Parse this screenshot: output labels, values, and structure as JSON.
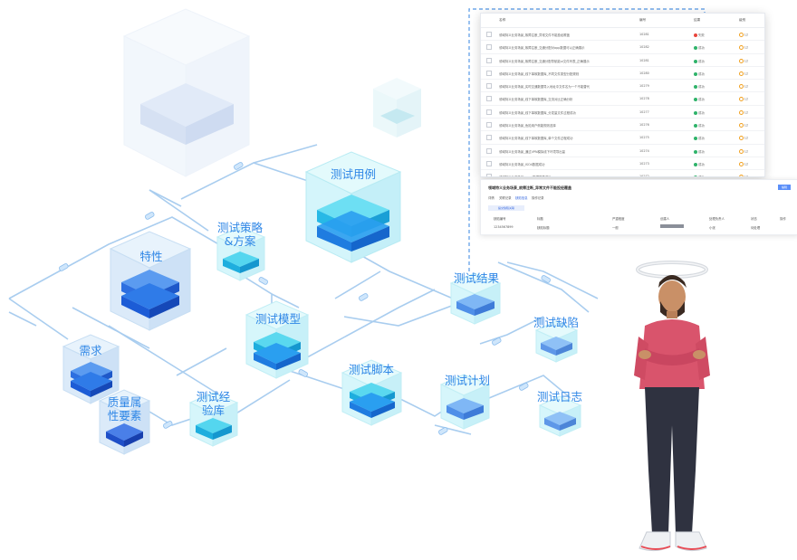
{
  "nodes": {
    "test_cases": "测试用例",
    "test_strategy": "测试策略\n&方案",
    "feature": "特性",
    "test_model": "测试模型",
    "requirement": "需求",
    "quality_attr": "质量属\n性要素",
    "test_experience": "测试经\n验库",
    "test_script": "测试脚本",
    "test_plan": "测试计划",
    "test_result": "测试结果",
    "test_defect": "测试缺陷",
    "test_log": "测试日志"
  },
  "panel": {
    "headers": {
      "name": "名称",
      "id": "编号",
      "status": "结果",
      "action": "级别"
    },
    "rows": [
      {
        "name": "领域特义业务场景_故障注断_异常文件不能投经覆盖",
        "id": "10281",
        "status": "失败",
        "level": "L2",
        "color": "#e8453c"
      },
      {
        "name": "领域特义业务场景_故障注断_交通分配对app数据可以正确展示",
        "id": "10282",
        "status": "成功",
        "level": "L2",
        "color": "#2fb36a"
      },
      {
        "name": "领域特义业务场景_故障注断_交通分配导航能ui文件列表_正确展示",
        "id": "10281",
        "status": "成功",
        "level": "L2",
        "color": "#2fb36a"
      },
      {
        "name": "领域特义业务场景_线下事故数据库_不同文件类型分配规则",
        "id": "10280",
        "status": "成功",
        "level": "L2",
        "color": "#2fb36a"
      },
      {
        "name": "领域特义业务场景_实时交通数据导入地址中文件名为一个不能替代",
        "id": "10279",
        "status": "成功",
        "level": "L2",
        "color": "#2fb36a"
      },
      {
        "name": "领域特义业务场景_线下事故数据库_交流对比正确分析",
        "id": "10278",
        "status": "成功",
        "level": "L2",
        "color": "#2fb36a"
      },
      {
        "name": "领域特义业务场景_线下事故数据库_分发量文件过程成功",
        "id": "10277",
        "status": "成功",
        "level": "L2",
        "color": "#2fb36a"
      },
      {
        "name": "领域特义业务场景_危险用户侧能规则选择",
        "id": "10276",
        "status": "成功",
        "level": "L2",
        "color": "#2fb36a"
      },
      {
        "name": "领域特义业务场景_线下事故数据库_单个文件过程成功",
        "id": "10275",
        "status": "成功",
        "level": "L2",
        "color": "#2fb36a"
      },
      {
        "name": "领域特义业务场景_通过VPN模拟线下环境导出量",
        "id": "10274",
        "status": "成功",
        "level": "L2",
        "color": "#2fb36a"
      },
      {
        "name": "领域特义业务场景_ISO4数据成功",
        "id": "10273",
        "status": "成功",
        "level": "L2",
        "color": "#2fb36a"
      },
      {
        "name": "领域特义业务场景_mapi数据图像成功",
        "id": "10272",
        "status": "成功",
        "level": "L2",
        "color": "#2fb36a"
      }
    ]
  },
  "detail": {
    "title": "领域特义业务场景_故障注断_异常文件不能投经覆盖",
    "top_button": "编辑",
    "tabs": [
      "详情",
      "关联记录",
      "缺陷信息",
      "操作记录"
    ],
    "add_button": "提交缺陷关联",
    "columns": [
      "缺陷编号",
      "标题",
      "严重程度",
      "创建人",
      "处理负责人",
      "状态",
      "操作"
    ],
    "cells": [
      "1234567899",
      "缺陷标题",
      "一般",
      "",
      "小张",
      "待处理",
      ""
    ]
  },
  "colors": {
    "accent": "#2e86e6",
    "line": "#a9cdef",
    "dash": "#6fa8ea",
    "cube_face": "#bfe8fb",
    "cube_layer": "#2a7df0"
  }
}
